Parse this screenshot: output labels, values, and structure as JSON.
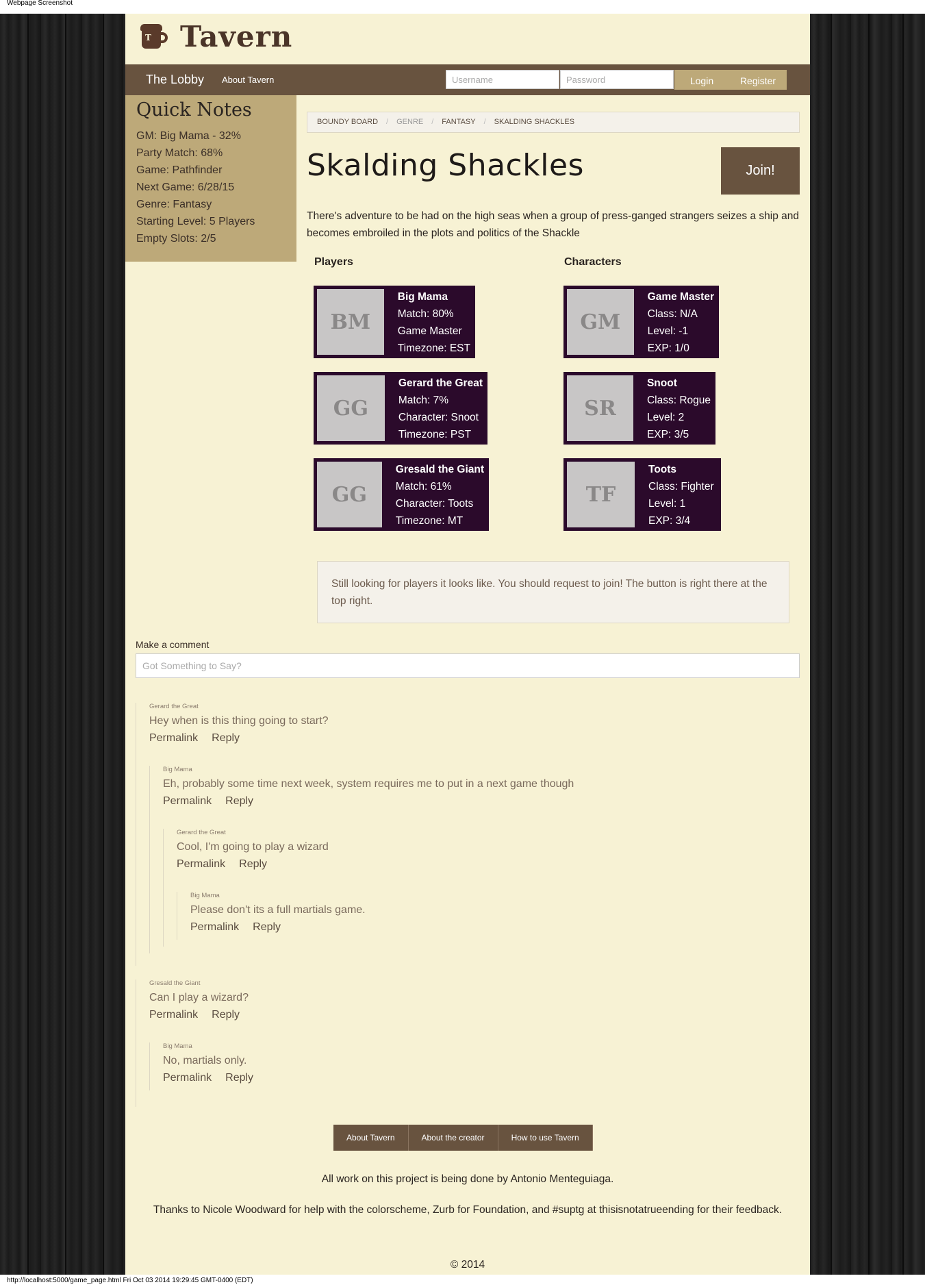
{
  "print": {
    "header": "Webpage Screenshot",
    "footer": "http://localhost:5000/game_page.html Fri Oct 03 2014 19:29:45 GMT-0400 (EDT)"
  },
  "brand": {
    "name": "Tavern",
    "logo_letter": "T"
  },
  "nav": {
    "lobby": "The Lobby",
    "about": "About Tavern",
    "username_placeholder": "Username",
    "password_placeholder": "Password",
    "login": "Login",
    "register": "Register"
  },
  "sidebar": {
    "title": "Quick Notes",
    "notes": [
      "GM: Big Mama - 32%",
      "Party Match: 68%",
      "Game: Pathfinder",
      "Next Game: 6/28/15",
      "Genre: Fantasy",
      "Starting Level: 5 Players",
      "Empty Slots: 2/5"
    ]
  },
  "breadcrumb": [
    "Boundy Board",
    "Genre",
    "Fantasy",
    "Skalding Shackles"
  ],
  "game": {
    "title": "Skalding Shackles",
    "join": "Join!",
    "description": "There's adventure to be had on the high seas when a group of press-ganged strangers seizes a ship and becomes embroiled in the plots and politics of the Shackle"
  },
  "players_heading": "Players",
  "characters_heading": "Characters",
  "players": [
    {
      "initials": "BM",
      "name": "Big Mama",
      "lines": [
        "Match: 80%",
        "Game Master",
        "Timezone: EST"
      ]
    },
    {
      "initials": "GG",
      "name": "Gerard the Great",
      "lines": [
        "Match: 7%",
        "Character: Snoot",
        "Timezone: PST"
      ]
    },
    {
      "initials": "GG",
      "name": "Gresald the Giant",
      "lines": [
        "Match: 61%",
        "Character: Toots",
        "Timezone: MT"
      ]
    }
  ],
  "characters": [
    {
      "initials": "GM",
      "name": "Game Master",
      "lines": [
        "Class: N/A",
        "Level: -1",
        "EXP: 1/0"
      ]
    },
    {
      "initials": "SR",
      "name": "Snoot",
      "lines": [
        "Class: Rogue",
        "Level: 2",
        "EXP: 3/5"
      ]
    },
    {
      "initials": "TF",
      "name": "Toots",
      "lines": [
        "Class: Fighter",
        "Level: 1",
        "EXP: 3/4"
      ]
    }
  ],
  "notice": "Still looking for players it looks like. You should request to join! The button is right there at the top right.",
  "comment_form": {
    "label": "Make a comment",
    "placeholder": "Got Something to Say?"
  },
  "comment_actions": {
    "permalink": "Permalink",
    "reply": "Reply"
  },
  "comments": [
    {
      "author": "Gerard the Great",
      "text": "Hey when is this thing going to start?"
    },
    {
      "author": "Big Mama",
      "text": "Eh, probably some time next week, system requires me to put in a next game though"
    },
    {
      "author": "Gerard the Great",
      "text": "Cool, I'm going to play a wizard"
    },
    {
      "author": "Big Mama",
      "text": "Please don't its a full martials game."
    },
    {
      "author": "Gresald the Giant",
      "text": "Can I play a wizard?"
    },
    {
      "author": "Big Mama",
      "text": "No, martials only."
    }
  ],
  "footer": {
    "links": [
      "About Tavern",
      "About the creator",
      "How to use Tavern"
    ],
    "credit": "All work on this project is being done by Antonio Menteguiaga.",
    "thanks": "Thanks to Nicole Woodward for help with the colorscheme, Zurb for Foundation, and #suptg at thisisnotatrueending for their feedback.",
    "copyright": "© 2014"
  }
}
